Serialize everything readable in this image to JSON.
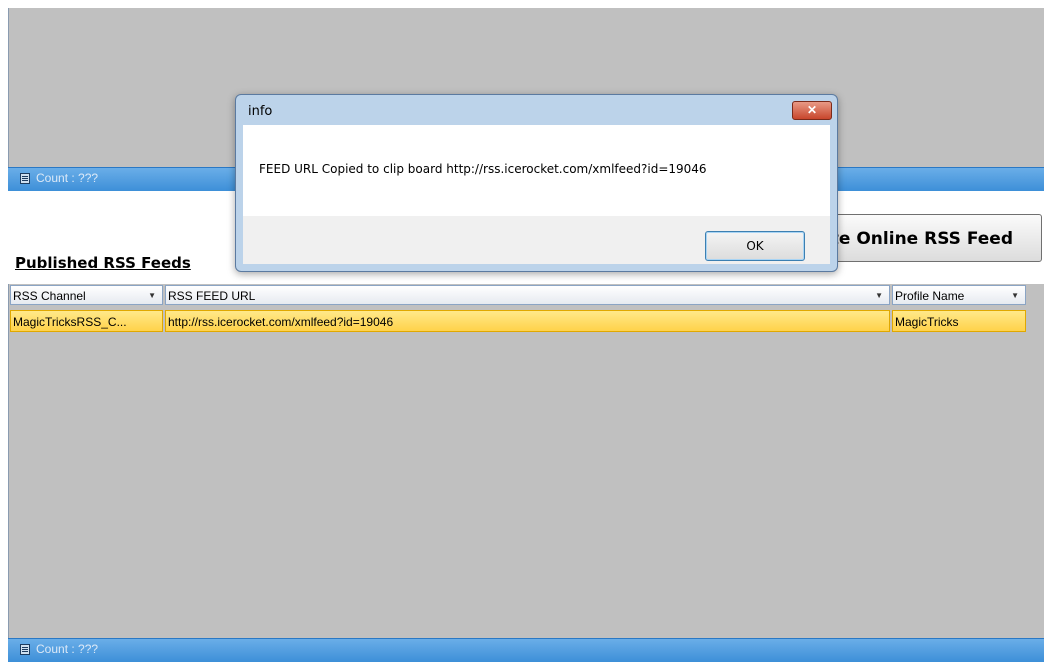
{
  "top_panel": {
    "count_label": "Count : ???"
  },
  "create_button": {
    "label": "te Online RSS Feed"
  },
  "feeds": {
    "title": "Published RSS Feeds",
    "columns": [
      "RSS Channel",
      "RSS FEED URL",
      "Profile Name"
    ],
    "rows": [
      {
        "channel": "MagicTricksRSS_C...",
        "url": "http://rss.icerocket.com/xmlfeed?id=19046",
        "profile": "MagicTricks"
      }
    ],
    "count_label": "Count : ???"
  },
  "dialog": {
    "title": "info",
    "close_glyph": "✕",
    "message": "FEED URL Copied to clip board http://rss.icerocket.com/xmlfeed?id=19046",
    "ok_label": "OK"
  }
}
